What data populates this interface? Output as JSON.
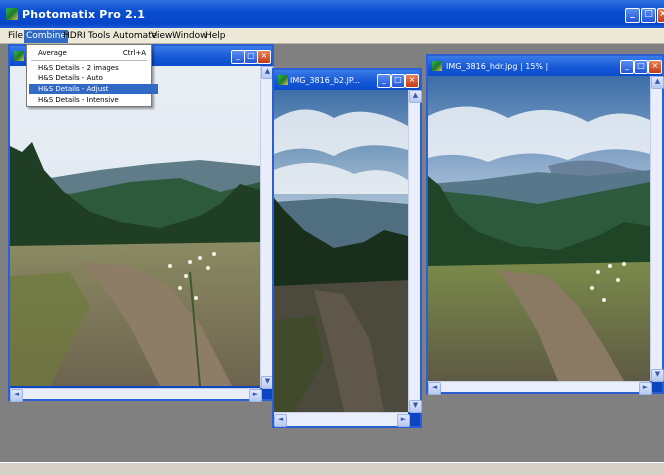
{
  "app": {
    "title": "Photomatix Pro 2.1"
  },
  "menubar": {
    "items": [
      "File",
      "Combine",
      "HDRI",
      "Tools",
      "Automate",
      "View",
      "Window",
      "Help"
    ],
    "active": "Combine"
  },
  "combine_menu": {
    "average": {
      "label": "Average",
      "shortcut": "Ctrl+A"
    },
    "items": [
      "H&S Details - 2 images",
      "H&S Details - Auto",
      "H&S Details - Adjust",
      "H&S Details - Intensive"
    ],
    "highlighted": "H&S Details - Adjust"
  },
  "windows": {
    "first": {
      "title": ""
    },
    "second": {
      "title": "IMG_3816_b2.JP..."
    },
    "third": {
      "title": "IMG_3816_hdr.jpg | 15% |"
    }
  },
  "colors": {
    "titlebar": "#0a4fd0",
    "menu_highlight": "#316ac5",
    "workspace": "#808080"
  }
}
